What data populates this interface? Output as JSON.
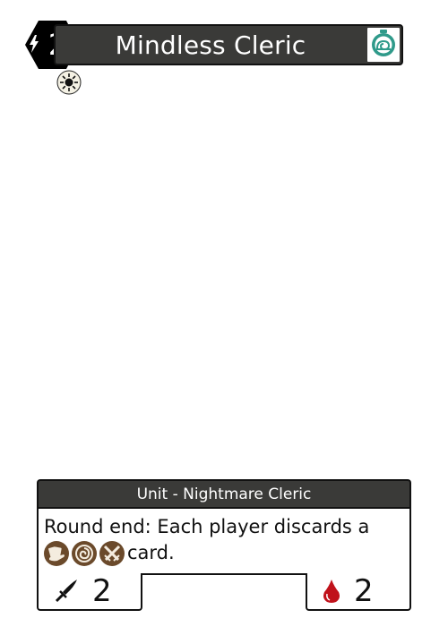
{
  "card": {
    "name": "Mindless Cleric",
    "cost": "2",
    "type_line": "Unit - Nightmare Cleric",
    "rules_line1": "Round end: Each player discards a",
    "rules_line2_suffix": "card.",
    "attack": "2",
    "health": "2"
  },
  "icons": {
    "cost": "lightning-bolt-icon",
    "speed": "snail-stopwatch-icon",
    "faction": "sun-icon",
    "resources": [
      "hand-cards-icon",
      "swirl-icon",
      "crossed-swords-icon"
    ],
    "attack": "sword-icon",
    "health": "blood-drop-icon"
  },
  "colors": {
    "bar": "#3a3a38",
    "speed_icon": "#2f9a8a",
    "resource_icon": "#6b4a2b",
    "blood": "#c0121b",
    "faction_bg": "#f4f1e4"
  }
}
